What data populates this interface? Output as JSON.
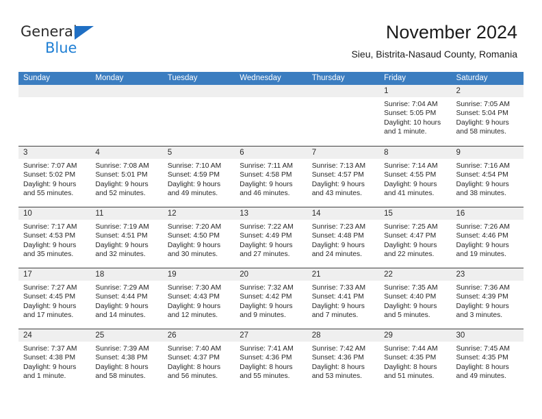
{
  "brand": {
    "word_one": "General",
    "word_two": "Blue",
    "triangle_icon": "brand-triangle-icon"
  },
  "header": {
    "month_title": "November 2024",
    "location": "Sieu, Bistrita-Nasaud County, Romania",
    "header_bg": "#3b7dc0",
    "brand_blue": "#1f7fd4"
  },
  "calendar": {
    "weekdays": [
      "Sunday",
      "Monday",
      "Tuesday",
      "Wednesday",
      "Thursday",
      "Friday",
      "Saturday"
    ],
    "weeks": [
      [
        {
          "day": "",
          "empty": true,
          "sunrise": "",
          "sunset": "",
          "daylight1": "",
          "daylight2": ""
        },
        {
          "day": "",
          "empty": true,
          "sunrise": "",
          "sunset": "",
          "daylight1": "",
          "daylight2": ""
        },
        {
          "day": "",
          "empty": true,
          "sunrise": "",
          "sunset": "",
          "daylight1": "",
          "daylight2": ""
        },
        {
          "day": "",
          "empty": true,
          "sunrise": "",
          "sunset": "",
          "daylight1": "",
          "daylight2": ""
        },
        {
          "day": "",
          "empty": true,
          "sunrise": "",
          "sunset": "",
          "daylight1": "",
          "daylight2": ""
        },
        {
          "day": "1",
          "empty": false,
          "sunrise": "Sunrise: 7:04 AM",
          "sunset": "Sunset: 5:05 PM",
          "daylight1": "Daylight: 10 hours",
          "daylight2": "and 1 minute."
        },
        {
          "day": "2",
          "empty": false,
          "sunrise": "Sunrise: 7:05 AM",
          "sunset": "Sunset: 5:04 PM",
          "daylight1": "Daylight: 9 hours",
          "daylight2": "and 58 minutes."
        }
      ],
      [
        {
          "day": "3",
          "empty": false,
          "sunrise": "Sunrise: 7:07 AM",
          "sunset": "Sunset: 5:02 PM",
          "daylight1": "Daylight: 9 hours",
          "daylight2": "and 55 minutes."
        },
        {
          "day": "4",
          "empty": false,
          "sunrise": "Sunrise: 7:08 AM",
          "sunset": "Sunset: 5:01 PM",
          "daylight1": "Daylight: 9 hours",
          "daylight2": "and 52 minutes."
        },
        {
          "day": "5",
          "empty": false,
          "sunrise": "Sunrise: 7:10 AM",
          "sunset": "Sunset: 4:59 PM",
          "daylight1": "Daylight: 9 hours",
          "daylight2": "and 49 minutes."
        },
        {
          "day": "6",
          "empty": false,
          "sunrise": "Sunrise: 7:11 AM",
          "sunset": "Sunset: 4:58 PM",
          "daylight1": "Daylight: 9 hours",
          "daylight2": "and 46 minutes."
        },
        {
          "day": "7",
          "empty": false,
          "sunrise": "Sunrise: 7:13 AM",
          "sunset": "Sunset: 4:57 PM",
          "daylight1": "Daylight: 9 hours",
          "daylight2": "and 43 minutes."
        },
        {
          "day": "8",
          "empty": false,
          "sunrise": "Sunrise: 7:14 AM",
          "sunset": "Sunset: 4:55 PM",
          "daylight1": "Daylight: 9 hours",
          "daylight2": "and 41 minutes."
        },
        {
          "day": "9",
          "empty": false,
          "sunrise": "Sunrise: 7:16 AM",
          "sunset": "Sunset: 4:54 PM",
          "daylight1": "Daylight: 9 hours",
          "daylight2": "and 38 minutes."
        }
      ],
      [
        {
          "day": "10",
          "empty": false,
          "sunrise": "Sunrise: 7:17 AM",
          "sunset": "Sunset: 4:53 PM",
          "daylight1": "Daylight: 9 hours",
          "daylight2": "and 35 minutes."
        },
        {
          "day": "11",
          "empty": false,
          "sunrise": "Sunrise: 7:19 AM",
          "sunset": "Sunset: 4:51 PM",
          "daylight1": "Daylight: 9 hours",
          "daylight2": "and 32 minutes."
        },
        {
          "day": "12",
          "empty": false,
          "sunrise": "Sunrise: 7:20 AM",
          "sunset": "Sunset: 4:50 PM",
          "daylight1": "Daylight: 9 hours",
          "daylight2": "and 30 minutes."
        },
        {
          "day": "13",
          "empty": false,
          "sunrise": "Sunrise: 7:22 AM",
          "sunset": "Sunset: 4:49 PM",
          "daylight1": "Daylight: 9 hours",
          "daylight2": "and 27 minutes."
        },
        {
          "day": "14",
          "empty": false,
          "sunrise": "Sunrise: 7:23 AM",
          "sunset": "Sunset: 4:48 PM",
          "daylight1": "Daylight: 9 hours",
          "daylight2": "and 24 minutes."
        },
        {
          "day": "15",
          "empty": false,
          "sunrise": "Sunrise: 7:25 AM",
          "sunset": "Sunset: 4:47 PM",
          "daylight1": "Daylight: 9 hours",
          "daylight2": "and 22 minutes."
        },
        {
          "day": "16",
          "empty": false,
          "sunrise": "Sunrise: 7:26 AM",
          "sunset": "Sunset: 4:46 PM",
          "daylight1": "Daylight: 9 hours",
          "daylight2": "and 19 minutes."
        }
      ],
      [
        {
          "day": "17",
          "empty": false,
          "sunrise": "Sunrise: 7:27 AM",
          "sunset": "Sunset: 4:45 PM",
          "daylight1": "Daylight: 9 hours",
          "daylight2": "and 17 minutes."
        },
        {
          "day": "18",
          "empty": false,
          "sunrise": "Sunrise: 7:29 AM",
          "sunset": "Sunset: 4:44 PM",
          "daylight1": "Daylight: 9 hours",
          "daylight2": "and 14 minutes."
        },
        {
          "day": "19",
          "empty": false,
          "sunrise": "Sunrise: 7:30 AM",
          "sunset": "Sunset: 4:43 PM",
          "daylight1": "Daylight: 9 hours",
          "daylight2": "and 12 minutes."
        },
        {
          "day": "20",
          "empty": false,
          "sunrise": "Sunrise: 7:32 AM",
          "sunset": "Sunset: 4:42 PM",
          "daylight1": "Daylight: 9 hours",
          "daylight2": "and 9 minutes."
        },
        {
          "day": "21",
          "empty": false,
          "sunrise": "Sunrise: 7:33 AM",
          "sunset": "Sunset: 4:41 PM",
          "daylight1": "Daylight: 9 hours",
          "daylight2": "and 7 minutes."
        },
        {
          "day": "22",
          "empty": false,
          "sunrise": "Sunrise: 7:35 AM",
          "sunset": "Sunset: 4:40 PM",
          "daylight1": "Daylight: 9 hours",
          "daylight2": "and 5 minutes."
        },
        {
          "day": "23",
          "empty": false,
          "sunrise": "Sunrise: 7:36 AM",
          "sunset": "Sunset: 4:39 PM",
          "daylight1": "Daylight: 9 hours",
          "daylight2": "and 3 minutes."
        }
      ],
      [
        {
          "day": "24",
          "empty": false,
          "sunrise": "Sunrise: 7:37 AM",
          "sunset": "Sunset: 4:38 PM",
          "daylight1": "Daylight: 9 hours",
          "daylight2": "and 1 minute."
        },
        {
          "day": "25",
          "empty": false,
          "sunrise": "Sunrise: 7:39 AM",
          "sunset": "Sunset: 4:38 PM",
          "daylight1": "Daylight: 8 hours",
          "daylight2": "and 58 minutes."
        },
        {
          "day": "26",
          "empty": false,
          "sunrise": "Sunrise: 7:40 AM",
          "sunset": "Sunset: 4:37 PM",
          "daylight1": "Daylight: 8 hours",
          "daylight2": "and 56 minutes."
        },
        {
          "day": "27",
          "empty": false,
          "sunrise": "Sunrise: 7:41 AM",
          "sunset": "Sunset: 4:36 PM",
          "daylight1": "Daylight: 8 hours",
          "daylight2": "and 55 minutes."
        },
        {
          "day": "28",
          "empty": false,
          "sunrise": "Sunrise: 7:42 AM",
          "sunset": "Sunset: 4:36 PM",
          "daylight1": "Daylight: 8 hours",
          "daylight2": "and 53 minutes."
        },
        {
          "day": "29",
          "empty": false,
          "sunrise": "Sunrise: 7:44 AM",
          "sunset": "Sunset: 4:35 PM",
          "daylight1": "Daylight: 8 hours",
          "daylight2": "and 51 minutes."
        },
        {
          "day": "30",
          "empty": false,
          "sunrise": "Sunrise: 7:45 AM",
          "sunset": "Sunset: 4:35 PM",
          "daylight1": "Daylight: 8 hours",
          "daylight2": "and 49 minutes."
        }
      ]
    ]
  }
}
